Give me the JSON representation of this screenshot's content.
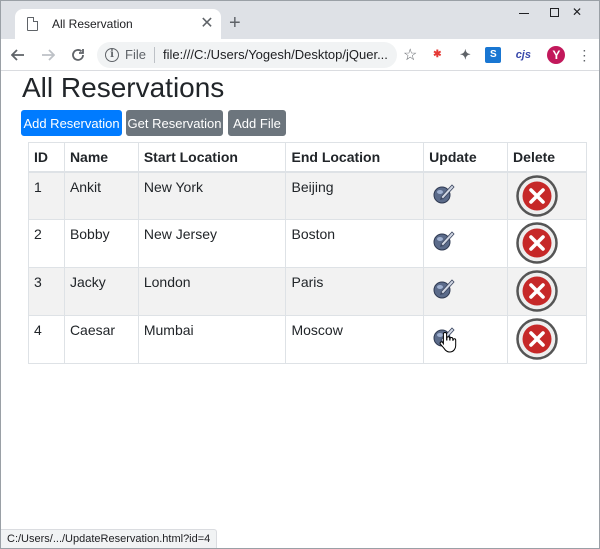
{
  "browser": {
    "tab_title": "All Reservation",
    "tab_close": "✕",
    "new_tab": "+",
    "win_close": "✕",
    "address_scheme": "File",
    "address_url": "file:///C:/Users/Yogesh/Desktop/jQuer...",
    "ext_cjs": "cjs",
    "ext_s": "S",
    "profile_initial": "Y",
    "status_url": "C:/Users/.../UpdateReservation.html?id=4"
  },
  "page": {
    "title": "All Reservations",
    "buttons": {
      "add_reservation": "Add Reservation",
      "get_reservation": "Get Reservation",
      "add_file": "Add File"
    },
    "table": {
      "headers": [
        "ID",
        "Name",
        "Start Location",
        "End Location",
        "Update",
        "Delete"
      ],
      "rows": [
        [
          "1",
          "Ankit",
          "New York",
          "Beijing"
        ],
        [
          "2",
          "Bobby",
          "New Jersey",
          "Boston"
        ],
        [
          "3",
          "Jacky",
          "London",
          "Paris"
        ],
        [
          "4",
          "Caesar",
          "Mumbai",
          "Moscow"
        ]
      ]
    }
  },
  "colors": {
    "primary": "#007bff",
    "secondary": "#6c757d",
    "delete_red": "#c62828"
  }
}
